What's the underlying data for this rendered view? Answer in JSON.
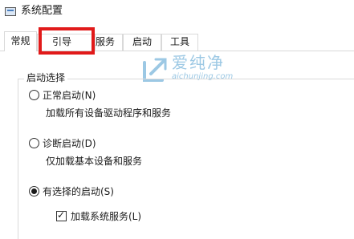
{
  "window": {
    "title": "系统配置"
  },
  "tabs": [
    {
      "label": "常规"
    },
    {
      "label": "引导"
    },
    {
      "label": "服务"
    },
    {
      "label": "启动"
    },
    {
      "label": "工具"
    }
  ],
  "tabs_visible": {
    "services_partial": "服务"
  },
  "startup_selection": {
    "group_title": "启动选择",
    "options": [
      {
        "label": "正常启动(N)",
        "description": "加载所有设备驱动程序和服务",
        "checked": false
      },
      {
        "label": "诊断启动(D)",
        "description": "仅加载基本设备和服务",
        "checked": false
      },
      {
        "label": "有选择的启动(S)",
        "checked": true
      }
    ],
    "load_system_services": {
      "label": "加载系统服务(L)",
      "checked": true
    }
  },
  "watermark": {
    "cn": "爱纯净",
    "en": "aichunjing.com"
  },
  "colors": {
    "highlight": "#e11a1a",
    "watermark": "#9cc8e4"
  }
}
